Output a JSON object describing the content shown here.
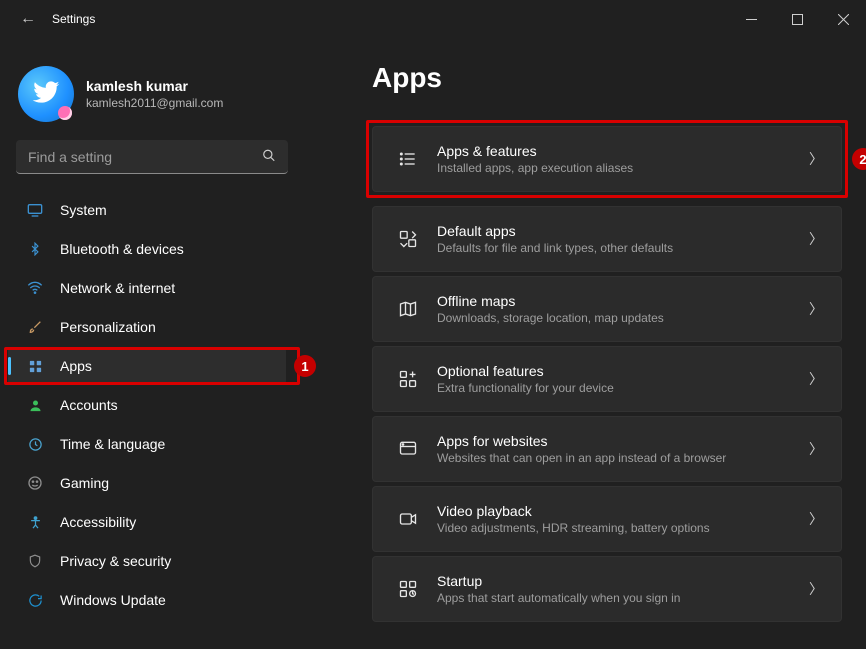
{
  "titlebar": {
    "title": "Settings"
  },
  "user": {
    "name": "kamlesh kumar",
    "email": "kamlesh2011@gmail.com"
  },
  "search": {
    "placeholder": "Find a setting"
  },
  "nav": {
    "items": [
      {
        "label": "System"
      },
      {
        "label": "Bluetooth & devices"
      },
      {
        "label": "Network & internet"
      },
      {
        "label": "Personalization"
      },
      {
        "label": "Apps"
      },
      {
        "label": "Accounts"
      },
      {
        "label": "Time & language"
      },
      {
        "label": "Gaming"
      },
      {
        "label": "Accessibility"
      },
      {
        "label": "Privacy & security"
      },
      {
        "label": "Windows Update"
      }
    ]
  },
  "annotations": {
    "step1": "1",
    "step2": "2"
  },
  "page": {
    "title": "Apps",
    "cards": [
      {
        "title": "Apps & features",
        "subtitle": "Installed apps, app execution aliases"
      },
      {
        "title": "Default apps",
        "subtitle": "Defaults for file and link types, other defaults"
      },
      {
        "title": "Offline maps",
        "subtitle": "Downloads, storage location, map updates"
      },
      {
        "title": "Optional features",
        "subtitle": "Extra functionality for your device"
      },
      {
        "title": "Apps for websites",
        "subtitle": "Websites that can open in an app instead of a browser"
      },
      {
        "title": "Video playback",
        "subtitle": "Video adjustments, HDR streaming, battery options"
      },
      {
        "title": "Startup",
        "subtitle": "Apps that start automatically when you sign in"
      }
    ]
  }
}
